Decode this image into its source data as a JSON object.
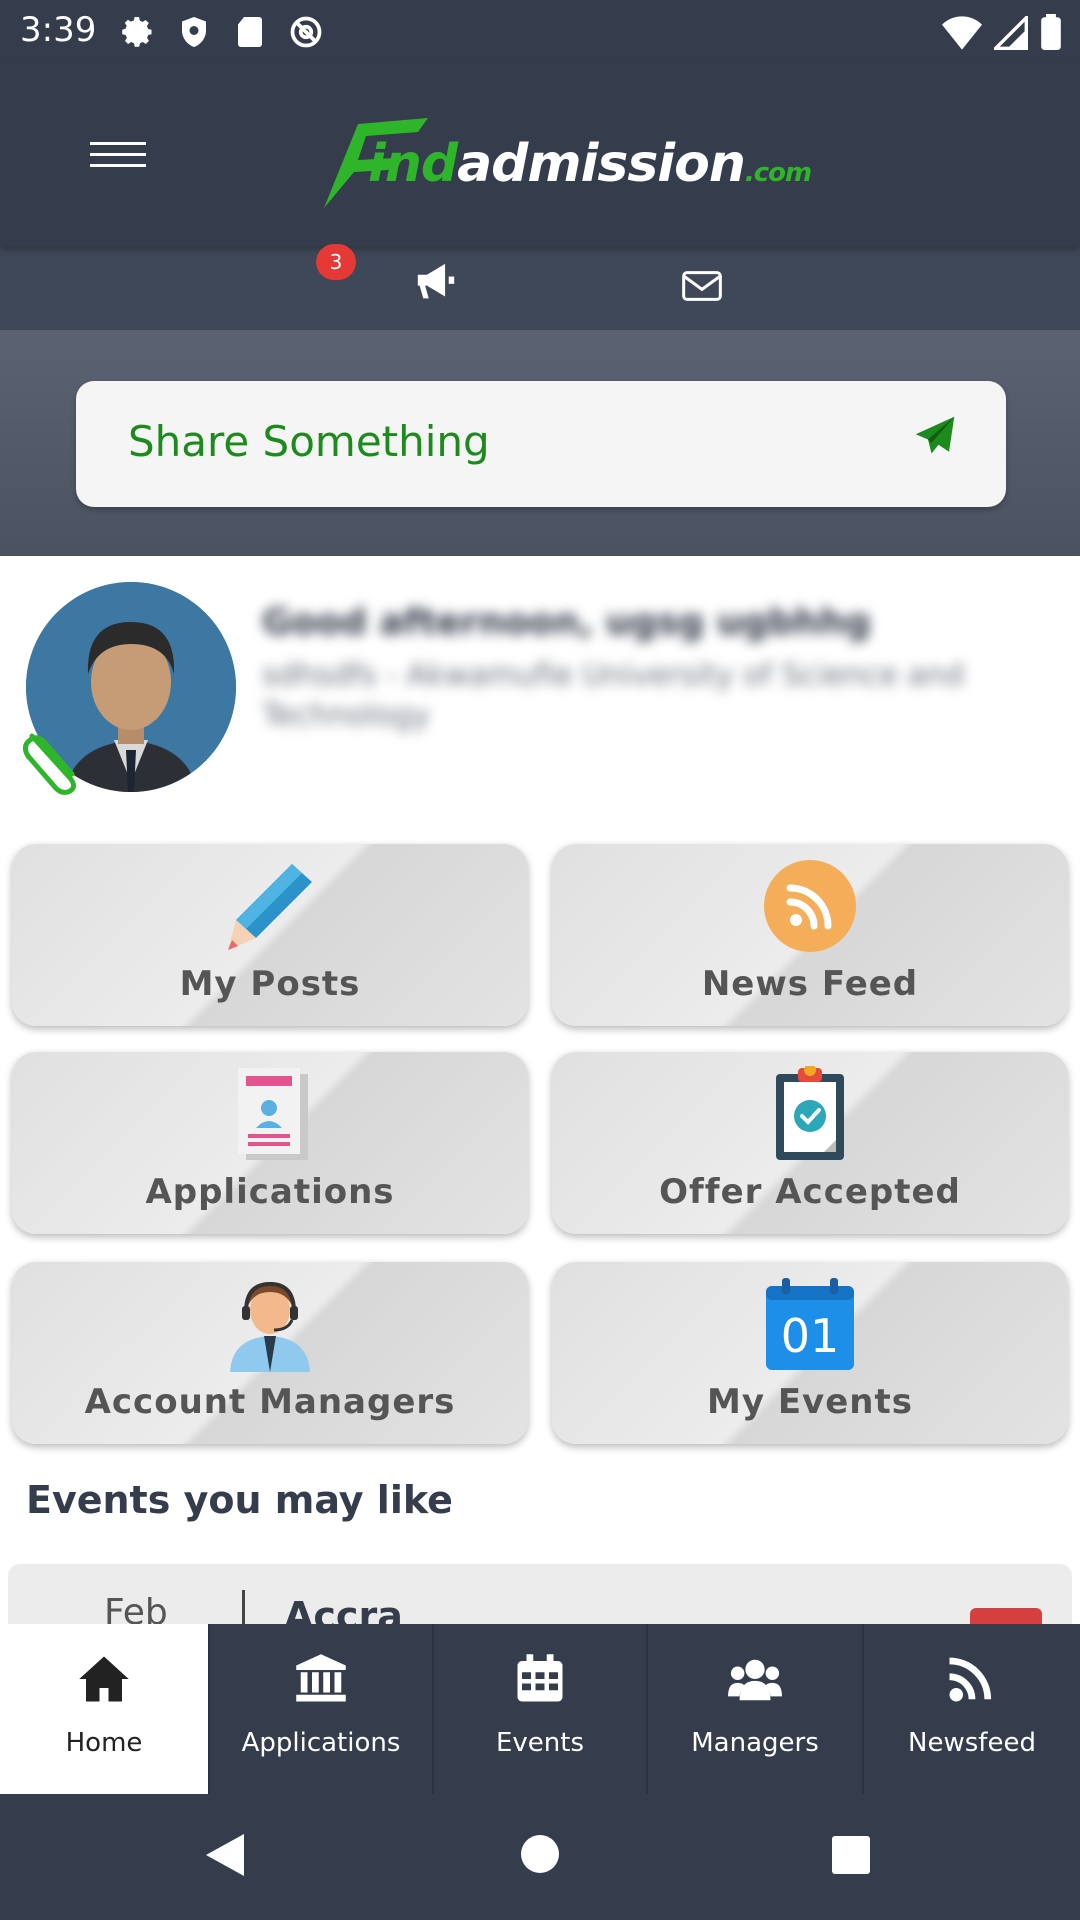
{
  "status_bar": {
    "time": "3:39",
    "left_icons": [
      "gear-icon",
      "shield-icon",
      "sd-card-icon",
      "at-sign-icon"
    ],
    "right_icons": [
      "wifi-icon",
      "signal-icon",
      "battery-icon"
    ]
  },
  "header": {
    "logo": {
      "find": "ind",
      "admission": "admission",
      "com": ".com"
    },
    "notification_count": "3"
  },
  "share": {
    "placeholder": "Share Something"
  },
  "profile": {
    "greeting": "Good afternoon, ugsg ugbhhg",
    "school": "sdhsdfs - Akwamufie University of Science and Technology"
  },
  "tiles": [
    {
      "label": "My Posts",
      "icon": "pencil-icon"
    },
    {
      "label": "News Feed",
      "icon": "rss-icon"
    },
    {
      "label": "Applications",
      "icon": "document-icon"
    },
    {
      "label": "Offer Accepted",
      "icon": "clipboard-check-icon"
    },
    {
      "label": "Account Managers",
      "icon": "support-agent-icon"
    },
    {
      "label": "My Events",
      "icon": "calendar-icon",
      "day": "01"
    }
  ],
  "events_section": {
    "title": "Events you may like",
    "card": {
      "month": "Feb",
      "city": "Accra"
    }
  },
  "bottom_nav": [
    {
      "label": "Home",
      "icon": "home-icon",
      "active": true
    },
    {
      "label": "Applications",
      "icon": "institution-icon",
      "active": false
    },
    {
      "label": "Events",
      "icon": "calendar-icon",
      "active": false
    },
    {
      "label": "Managers",
      "icon": "users-icon",
      "active": false
    },
    {
      "label": "Newsfeed",
      "icon": "rss-icon",
      "active": false
    }
  ],
  "colors": {
    "header_bg": "#353d4c",
    "accent_green": "#2fb52a",
    "badge_red": "#e53935"
  }
}
